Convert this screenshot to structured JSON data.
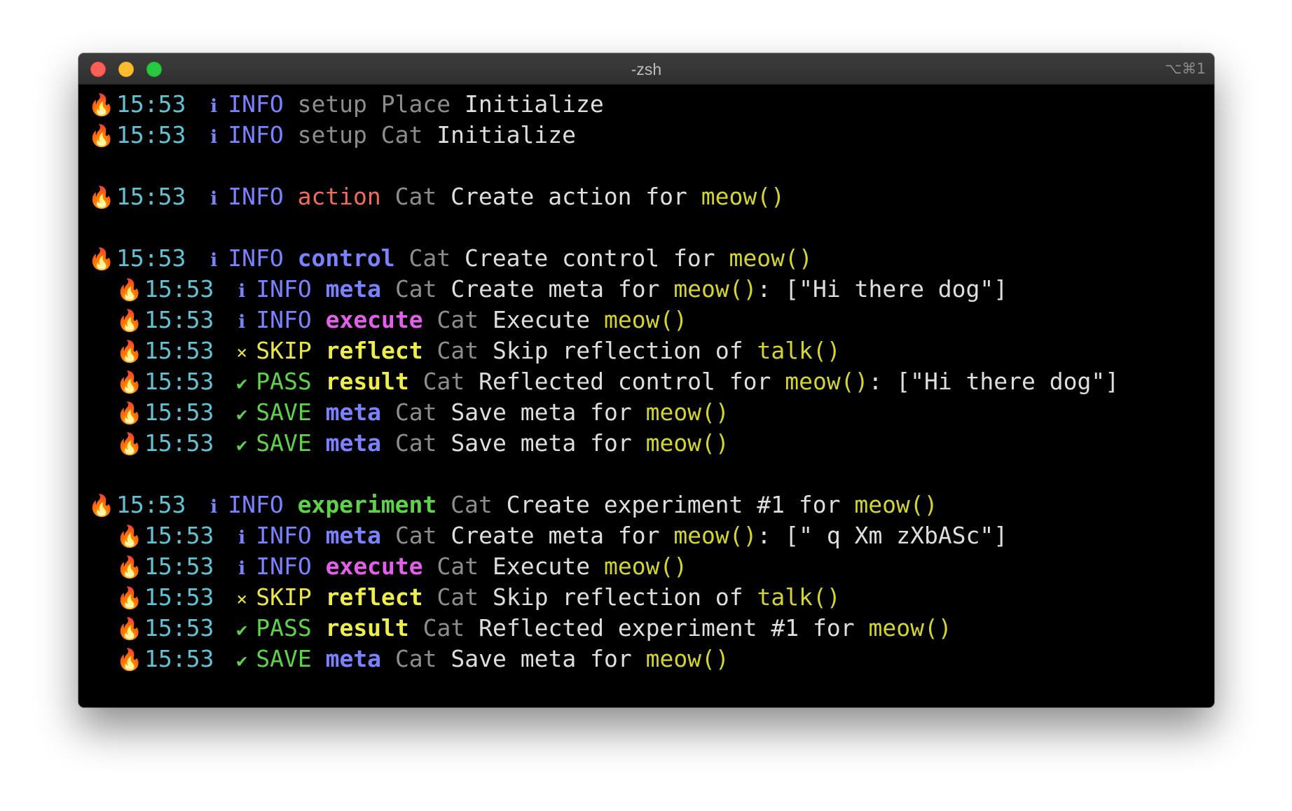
{
  "window": {
    "title": "-zsh",
    "shortcut": "⌥⌘1"
  },
  "colors": {
    "time": "#5fc3d3",
    "info": "#7b82ff",
    "skip": "#e8e44a",
    "pass": "#5ed34a",
    "action": "#f26b5b",
    "execute": "#e35fe9",
    "function": "#d4d430"
  },
  "lines": [
    {
      "indent": false,
      "icon": "fire-icon",
      "emoji": "🔥",
      "time": "15:53",
      "symbol": "ℹ",
      "symbol_kind": "info",
      "level": "INFO",
      "level_kind": "info",
      "category": "setup",
      "category_kind": "setup",
      "scope": "Place",
      "message": "Initialize",
      "fn": "",
      "extra": ""
    },
    {
      "indent": false,
      "icon": "fire-icon",
      "emoji": "🔥",
      "time": "15:53",
      "symbol": "ℹ",
      "symbol_kind": "info",
      "level": "INFO",
      "level_kind": "info",
      "category": "setup",
      "category_kind": "setup",
      "scope": "Cat",
      "message": "Initialize",
      "fn": "",
      "extra": ""
    },
    {
      "blank": true
    },
    {
      "indent": false,
      "icon": "fire-icon",
      "emoji": "🔥",
      "time": "15:53",
      "symbol": "ℹ",
      "symbol_kind": "info",
      "level": "INFO",
      "level_kind": "info",
      "category": "action",
      "category_kind": "action",
      "scope": "Cat",
      "message": "Create action for",
      "fn": "meow()",
      "extra": ""
    },
    {
      "blank": true
    },
    {
      "indent": false,
      "icon": "fire-icon",
      "emoji": "🔥",
      "time": "15:53",
      "symbol": "ℹ",
      "symbol_kind": "info",
      "level": "INFO",
      "level_kind": "info",
      "category": "control",
      "category_kind": "control",
      "scope": "Cat",
      "message": "Create control for",
      "fn": "meow()",
      "extra": ""
    },
    {
      "indent": true,
      "icon": "fire-icon",
      "emoji": "🔥",
      "time": "15:53",
      "symbol": "ℹ",
      "symbol_kind": "info",
      "level": "INFO",
      "level_kind": "info",
      "category": "meta",
      "category_kind": "meta",
      "scope": "Cat",
      "message": "Create meta for",
      "fn": "meow()",
      "extra": ": [\"Hi there dog\"]"
    },
    {
      "indent": true,
      "icon": "fire-icon",
      "emoji": "🔥",
      "time": "15:53",
      "symbol": "ℹ",
      "symbol_kind": "info",
      "level": "INFO",
      "level_kind": "info",
      "category": "execute",
      "category_kind": "execute",
      "scope": "Cat",
      "message": "Execute",
      "fn": "meow()",
      "extra": ""
    },
    {
      "indent": true,
      "icon": "fire-icon",
      "emoji": "🔥",
      "time": "15:53",
      "symbol": "×",
      "symbol_kind": "skip",
      "level": "SKIP",
      "level_kind": "skip",
      "category": "reflect",
      "category_kind": "reflect",
      "scope": "Cat",
      "message": "Skip reflection of",
      "fn": "talk()",
      "extra": ""
    },
    {
      "indent": true,
      "icon": "fire-icon",
      "emoji": "🔥",
      "time": "15:53",
      "symbol": "✔",
      "symbol_kind": "pass",
      "level": "PASS",
      "level_kind": "pass",
      "category": "result",
      "category_kind": "result",
      "scope": "Cat",
      "message": "Reflected control for",
      "fn": "meow()",
      "extra": ": [\"Hi there dog\"]"
    },
    {
      "indent": true,
      "icon": "fire-icon",
      "emoji": "🔥",
      "time": "15:53",
      "symbol": "✔",
      "symbol_kind": "pass",
      "level": "SAVE",
      "level_kind": "save",
      "category": "meta",
      "category_kind": "meta",
      "scope": "Cat",
      "message": "Save meta for",
      "fn": "meow()",
      "extra": ""
    },
    {
      "indent": true,
      "icon": "fire-icon",
      "emoji": "🔥",
      "time": "15:53",
      "symbol": "✔",
      "symbol_kind": "pass",
      "level": "SAVE",
      "level_kind": "save",
      "category": "meta",
      "category_kind": "meta",
      "scope": "Cat",
      "message": "Save meta for",
      "fn": "meow()",
      "extra": ""
    },
    {
      "blank": true
    },
    {
      "indent": false,
      "icon": "fire-icon",
      "emoji": "🔥",
      "time": "15:53",
      "symbol": "ℹ",
      "symbol_kind": "info",
      "level": "INFO",
      "level_kind": "info",
      "category": "experiment",
      "category_kind": "experiment",
      "scope": "Cat",
      "message": "Create experiment #1 for",
      "fn": "meow()",
      "extra": ""
    },
    {
      "indent": true,
      "icon": "fire-icon",
      "emoji": "🔥",
      "time": "15:53",
      "symbol": "ℹ",
      "symbol_kind": "info",
      "level": "INFO",
      "level_kind": "info",
      "category": "meta",
      "category_kind": "meta",
      "scope": "Cat",
      "message": "Create meta for",
      "fn": "meow()",
      "extra": ": [\" q Xm zXbASc\"]"
    },
    {
      "indent": true,
      "icon": "fire-icon",
      "emoji": "🔥",
      "time": "15:53",
      "symbol": "ℹ",
      "symbol_kind": "info",
      "level": "INFO",
      "level_kind": "info",
      "category": "execute",
      "category_kind": "execute",
      "scope": "Cat",
      "message": "Execute",
      "fn": "meow()",
      "extra": ""
    },
    {
      "indent": true,
      "icon": "fire-icon",
      "emoji": "🔥",
      "time": "15:53",
      "symbol": "×",
      "symbol_kind": "skip",
      "level": "SKIP",
      "level_kind": "skip",
      "category": "reflect",
      "category_kind": "reflect",
      "scope": "Cat",
      "message": "Skip reflection of",
      "fn": "talk()",
      "extra": ""
    },
    {
      "indent": true,
      "icon": "fire-icon",
      "emoji": "🔥",
      "time": "15:53",
      "symbol": "✔",
      "symbol_kind": "pass",
      "level": "PASS",
      "level_kind": "pass",
      "category": "result",
      "category_kind": "result",
      "scope": "Cat",
      "message": "Reflected experiment #1 for",
      "fn": "meow()",
      "extra": ""
    },
    {
      "indent": true,
      "icon": "fire-icon",
      "emoji": "🔥",
      "time": "15:53",
      "symbol": "✔",
      "symbol_kind": "pass",
      "level": "SAVE",
      "level_kind": "save",
      "category": "meta",
      "category_kind": "meta",
      "scope": "Cat",
      "message": "Save meta for",
      "fn": "meow()",
      "extra": ""
    }
  ]
}
